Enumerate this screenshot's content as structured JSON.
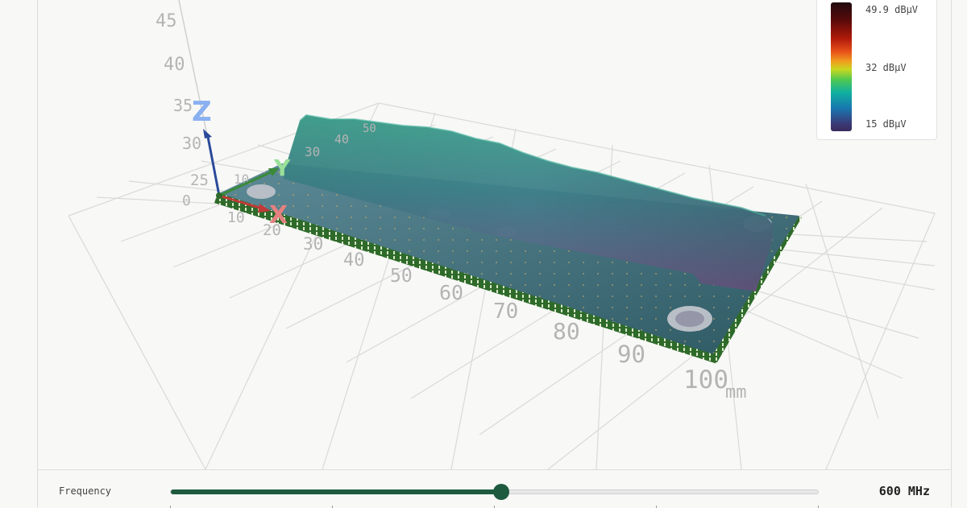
{
  "colors": {
    "accent": "#1e5a3e",
    "axis_x": "#e06060",
    "axis_y": "#90e090",
    "axis_z": "#8ab0f0",
    "axis_z_arrow": "#2a4a9a",
    "board": "#2a5a66",
    "board_edge": "#2e6a2a"
  },
  "scene": {
    "z_ticks": [
      "45",
      "40",
      "35",
      "30",
      "25",
      "0"
    ],
    "y_ticks": [
      "10",
      "30",
      "40",
      "50"
    ],
    "x_ticks": [
      "10",
      "20",
      "30",
      "40",
      "50",
      "60",
      "70",
      "80",
      "90",
      "100"
    ],
    "unit": "mm",
    "axis_labels": {
      "x": "X",
      "y": "Y",
      "z": "Z"
    }
  },
  "legend": {
    "max_label": "49.9 dBµV",
    "mid_label": "32 dBµV",
    "min_label": "15 dBµV"
  },
  "controls": {
    "frequency_label": "Frequency",
    "frequency_value": "600 MHz",
    "slider_fraction": 0.51
  }
}
